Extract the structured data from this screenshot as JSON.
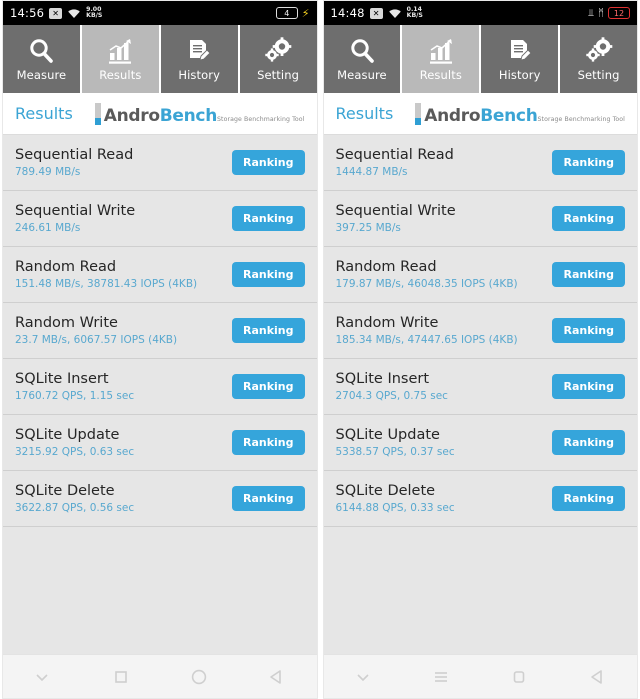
{
  "phones": [
    {
      "id": "left",
      "statusbar": {
        "time": "14:56",
        "x_icon": "x",
        "wifi_icon": "wifi-icon",
        "netspeed_value": "9.00",
        "netspeed_unit": "KB/S",
        "battery_level": "4",
        "charging_icon": "charging-bolt-icon",
        "battery_low": false
      },
      "tabs": [
        {
          "label": "Measure",
          "icon": "magnifier-icon",
          "active": false
        },
        {
          "label": "Results",
          "icon": "bar-chart-icon",
          "active": true
        },
        {
          "label": "History",
          "icon": "document-pen-icon",
          "active": false
        },
        {
          "label": "Setting",
          "icon": "gears-icon",
          "active": false
        }
      ],
      "header": {
        "title": "Results",
        "brand_first": "Andro",
        "brand_second": "Bench",
        "brand_tagline": "Storage Benchmarking Tool"
      },
      "rows": [
        {
          "title": "Sequential Read",
          "value": "789.49 MB/s",
          "button": "Ranking"
        },
        {
          "title": "Sequential Write",
          "value": "246.61 MB/s",
          "button": "Ranking"
        },
        {
          "title": "Random Read",
          "value": "151.48 MB/s, 38781.43 IOPS (4KB)",
          "button": "Ranking"
        },
        {
          "title": "Random Write",
          "value": "23.7 MB/s, 6067.57 IOPS (4KB)",
          "button": "Ranking"
        },
        {
          "title": "SQLite Insert",
          "value": "1760.72 QPS, 1.15 sec",
          "button": "Ranking"
        },
        {
          "title": "SQLite Update",
          "value": "3215.92 QPS, 0.63 sec",
          "button": "Ranking"
        },
        {
          "title": "SQLite Delete",
          "value": "3622.87 QPS, 0.56 sec",
          "button": "Ranking"
        }
      ],
      "navbar": [
        "chevron-down-icon",
        "square-recents-icon",
        "circle-home-icon",
        "triangle-back-icon"
      ]
    },
    {
      "id": "right",
      "statusbar": {
        "time": "14:48",
        "x_icon": "x",
        "wifi_icon": "wifi-icon",
        "netspeed_value": "0.14",
        "netspeed_unit": "KB/S",
        "battery_level": "12",
        "vibrate_icon": "vibrate-icon",
        "bluetooth_icon": "bluetooth-icon",
        "battery_low": true
      },
      "tabs": [
        {
          "label": "Measure",
          "icon": "magnifier-icon",
          "active": false
        },
        {
          "label": "Results",
          "icon": "bar-chart-icon",
          "active": true
        },
        {
          "label": "History",
          "icon": "document-pen-icon",
          "active": false
        },
        {
          "label": "Setting",
          "icon": "gears-icon",
          "active": false
        }
      ],
      "header": {
        "title": "Results",
        "brand_first": "Andro",
        "brand_second": "Bench",
        "brand_tagline": "Storage Benchmarking Tool"
      },
      "rows": [
        {
          "title": "Sequential Read",
          "value": "1444.87 MB/s",
          "button": "Ranking"
        },
        {
          "title": "Sequential Write",
          "value": "397.25 MB/s",
          "button": "Ranking"
        },
        {
          "title": "Random Read",
          "value": "179.87 MB/s, 46048.35 IOPS (4KB)",
          "button": "Ranking"
        },
        {
          "title": "Random Write",
          "value": "185.34 MB/s, 47447.65 IOPS (4KB)",
          "button": "Ranking"
        },
        {
          "title": "SQLite Insert",
          "value": "2704.3 QPS, 0.75 sec",
          "button": "Ranking"
        },
        {
          "title": "SQLite Update",
          "value": "5338.57 QPS, 0.37 sec",
          "button": "Ranking"
        },
        {
          "title": "SQLite Delete",
          "value": "6144.88 QPS, 0.33 sec",
          "button": "Ranking"
        }
      ],
      "navbar": [
        "chevron-down-icon",
        "hamburger-menu-icon",
        "rounded-square-home-icon",
        "triangle-back-icon"
      ]
    }
  ],
  "colors": {
    "accent": "#35a5db",
    "tab_inactive": "#6e6e6e",
    "tab_active": "#b9b9b9",
    "list_bg": "#e6e6e6",
    "sub_text": "#58a8cf",
    "battery_low": "#e03232"
  }
}
